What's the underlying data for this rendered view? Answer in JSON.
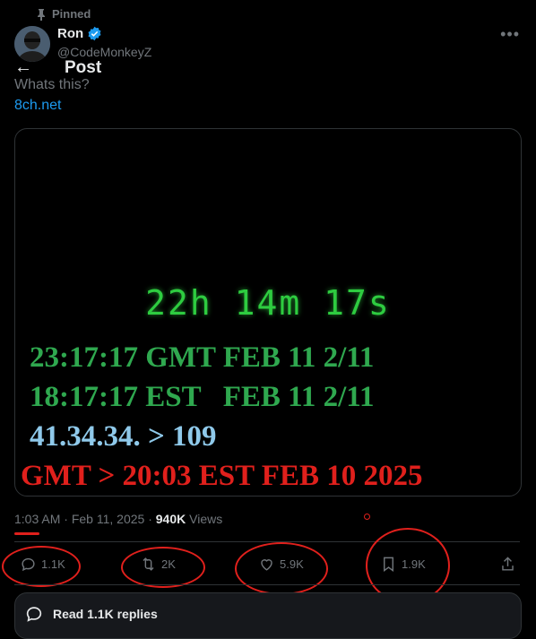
{
  "pinned_label": "Pinned",
  "author": {
    "name": "Ron",
    "handle": "@CodeMonkeyZ"
  },
  "header": {
    "title": "Post"
  },
  "post": {
    "text": "Whats this?",
    "link": "8ch.net"
  },
  "media": {
    "countdown": "22h 14m 17s",
    "line1": "23:17:17 GMT FEB 11 2/11",
    "line2": "18:17:17 EST   FEB 11 2/11",
    "line3": "41.34.34. > 109",
    "line4": "GMT > 20:03 EST FEB 10 2025"
  },
  "meta": {
    "time": "1:03 AM",
    "date": "Feb 11, 2025",
    "views_count": "940K",
    "views_label": "Views",
    "separator": "·"
  },
  "actions": {
    "replies": "1.1K",
    "reposts": "2K",
    "likes": "5.9K",
    "bookmarks": "1.9K"
  },
  "replies_bar": {
    "label": "Read 1.1K replies"
  },
  "colors": {
    "background": "#000000",
    "accent": "#1d9bf0",
    "muted": "#71767b",
    "green": "#2ecc40",
    "red": "#e0201c",
    "light_blue": "#8fc9ea"
  },
  "icons": [
    "pin-icon",
    "verified-icon",
    "more-icon",
    "back-arrow-icon",
    "reply-icon",
    "repost-icon",
    "like-icon",
    "bookmark-icon",
    "share-icon",
    "chat-bubble-icon"
  ]
}
